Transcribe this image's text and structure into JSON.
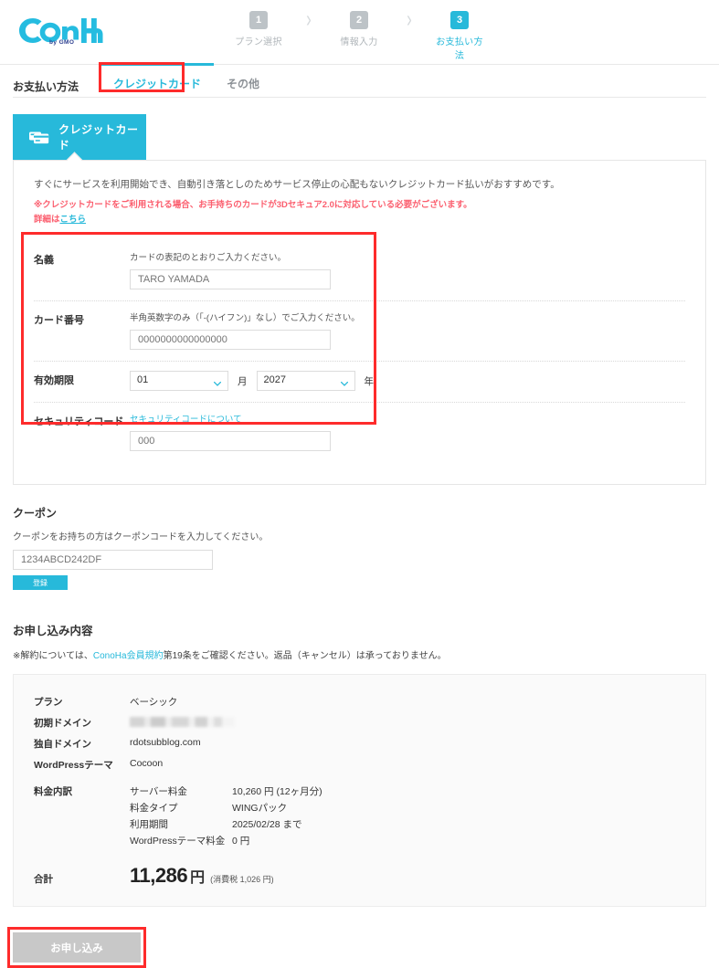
{
  "header": {
    "logo_text": "ConoHa",
    "logo_sub": "by GMO",
    "steps": [
      {
        "num": "1",
        "label": "プラン選択",
        "active": false
      },
      {
        "num": "2",
        "label": "情報入力",
        "active": false
      },
      {
        "num": "3",
        "label": "お支払い方法",
        "active": true
      }
    ],
    "separator": "›"
  },
  "tabs": {
    "title": "お支払い方法",
    "items": [
      {
        "label": "クレジットカード",
        "active": true
      },
      {
        "label": "その他",
        "active": false
      }
    ]
  },
  "credit_card_tab": {
    "label": "クレジットカード",
    "icon": "credit-card-icon"
  },
  "panel": {
    "description": "すぐにサービスを利用開始でき、自動引き落としのためサービス停止の心配もないクレジットカード払いがおすすめです。",
    "warning_line1": "※クレジットカードをご利用される場合、お手持ちのカードが3Dセキュア2.0に対応している必要がございます。",
    "warning_prefix": "詳細は",
    "warning_link": "こちら"
  },
  "form": {
    "name": {
      "label": "名義",
      "hint": "カードの表記のとおりご入力ください。",
      "placeholder": "TARO YAMADA",
      "value": ""
    },
    "card_number": {
      "label": "カード番号",
      "hint": "半角英数字のみ（「-(ハイフン)」なし）でご入力ください。",
      "placeholder": "0000000000000000",
      "value": ""
    },
    "expiry": {
      "label": "有効期限",
      "month_value": "01",
      "month_unit": "月",
      "year_value": "2027",
      "year_unit": "年"
    },
    "security_code": {
      "label": "セキュリティコード",
      "link": "セキュリティコードについて",
      "placeholder": "000",
      "value": ""
    }
  },
  "coupon": {
    "title": "クーポン",
    "description": "クーポンをお持ちの方はクーポンコードを入力してください。",
    "placeholder": "1234ABCD242DF",
    "value": "",
    "button": "登録"
  },
  "order": {
    "title": "お申し込み内容",
    "note_prefix": "※解約については、",
    "note_link": "ConoHa会員規約",
    "note_suffix": "第19条をご確認ください。返品（キャンセル）は承っておりません。",
    "rows": [
      {
        "key": "プラン",
        "value": "ベーシック",
        "redacted": false
      },
      {
        "key": "初期ドメイン",
        "value": "",
        "redacted": true
      },
      {
        "key": "独自ドメイン",
        "value": "rdotsubblog.com",
        "redacted": false
      },
      {
        "key": "WordPressテーマ",
        "value": "Cocoon",
        "redacted": false
      }
    ],
    "breakdown_key": "料金内訳",
    "breakdown": [
      {
        "key": "サーバー料金",
        "value": "10,260 円 (12ヶ月分)"
      },
      {
        "key": "料金タイプ",
        "value": "WINGパック"
      },
      {
        "key": "利用期間",
        "value": "2025/02/28 まで"
      },
      {
        "key": "WordPressテーマ料金",
        "value": "0 円"
      }
    ],
    "total_key": "合計",
    "total_value": "11,286",
    "total_currency": "円",
    "total_tax": "(消費税 1,026 円)"
  },
  "submit": {
    "label": "お申し込み"
  },
  "colors": {
    "accent": "#27b9da",
    "warning": "#fb5e6e",
    "annotation": "#fe2b2b",
    "disabled": "#c8c8c8"
  }
}
